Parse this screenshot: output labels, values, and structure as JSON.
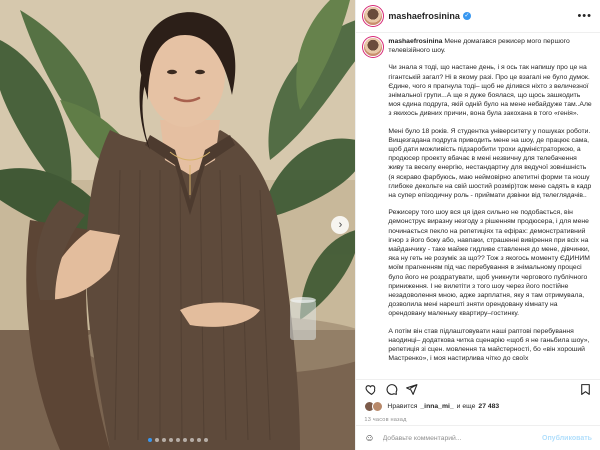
{
  "post": {
    "username": "mashaefrosinina",
    "more_glyph": "•••",
    "verified_glyph": "✓",
    "slide_total": 9,
    "slide_active": 1,
    "next_glyph": "›"
  },
  "caption": {
    "username": "mashaefrosinina",
    "paragraphs": [
      "Мене домагався режисер мого першого телевізійного шоу.",
      "Чи знала я тоді, що настане день, і я ось так напишу про це на гігантській загал? Ні в якому разі. Про це взагалі не було думок. Єдине, чого я прагнула тоді– щоб не ділився ніхто з величезної знімальної групи...А ще я дуже боялася, що щось зашкодить моя єдина подруга, якій одній було на мене небайдуже там..Але з якихось дивних причин, вона була закохана в того «генія».",
      "Мені було 18 років. Я студентка університету у пошуках роботи. Вищезгадана подруга приводить мене на шоу, де працює сама, щоб дати можливість підзаробити трохи адміністраторкою, а продюсер проекту вбачає в мені незвичну для телебачення живу та веселу енергію, нестандартну для ведучої зовнішність (я яскраво фарбуюсь, маю неймовірно апетитні форми та ношу глибоке декольте на свій шостий розмір)тож мене садять в кадр на супер епізодичну роль - приймати дзвінки від телеглядачів..",
      "Режисеру того шоу вся ця ідея сильно не подобається, він демонструє виразну незгоду з рішенням продюсера, і для мене починається пекло на репетиціях та ефірах: демонстративний ігнор з його боку або, навпаки, страшенні вивірення при всіх на майданчику - таке майже гидливе ставлення до мене, дівчинки, яка ну геть не розуміє за що?? Тож з якогось моменту ЄДИНИМ моїм прагненням під час перебування в знімальному процесі було його не роздратувати, щоб уникнути чергового публічного приниження. І не вилетіти з того шоу через його постійне незадоволення мною, адже зарплатня, яку я там отримувала, дозволила мені нарешті зняти орендовану кімнату на орендовану маленьку квартиру–гостинку.",
      "А потім він став підлаштовувати наші раптові перебування наодинці– додаткова читка сценарію «щоб я не ганьбила шоу», репетиція зі сцен. мовлення та майстерності, бо «він хороший Мастренко», і моя настирлива чітко до своїх"
    ]
  },
  "likes": {
    "prefix": "Нравится",
    "user": "_inna_mi_",
    "connector": "и еще",
    "count": "27 483"
  },
  "timestamp": "13 часов назад",
  "comment": {
    "emoji_glyph": "☺",
    "placeholder": "Добавьте комментарий...",
    "publish_label": "Опубликовать"
  }
}
